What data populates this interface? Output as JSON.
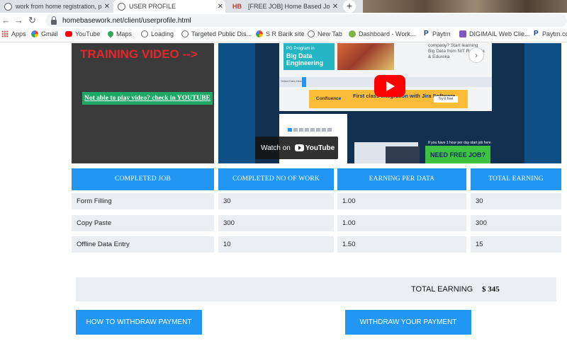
{
  "browser": {
    "tabs": [
      {
        "title": "work from home registration, pa"
      },
      {
        "title": "USER PROFILE"
      },
      {
        "title": "[FREE JOB] Home Based Jobs Wit",
        "favicon_text": "HB"
      }
    ],
    "url": "homebasework.net/client/userprofile.html",
    "bookmarks": [
      {
        "label": "Apps",
        "icon": "apps-grid-icon"
      },
      {
        "label": "Gmail",
        "icon": "google-icon"
      },
      {
        "label": "YouTube",
        "icon": "youtube-icon"
      },
      {
        "label": "Maps",
        "icon": "maps-pin-icon"
      },
      {
        "label": "Loading",
        "icon": "globe-icon"
      },
      {
        "label": "Targeted Public Dis...",
        "icon": "globe-icon"
      },
      {
        "label": "S R Barik site",
        "icon": "google-icon"
      },
      {
        "label": "New Tab",
        "icon": "globe-icon"
      },
      {
        "label": "Dashboard - Work...",
        "icon": "dashboard-icon"
      },
      {
        "label": "Paytm",
        "icon": "paytm-icon"
      },
      {
        "label": "DIGIMAIL Web Clie...",
        "icon": "digimail-icon"
      },
      {
        "label": "Paytm.co",
        "icon": "paytm-icon"
      }
    ]
  },
  "training": {
    "heading": "TRAINING VIDEO -->",
    "youtube_link": "Not able to play video? check in YOUTUBE"
  },
  "video": {
    "big_data_small": "PG Program in",
    "big_data_title": "Big Data Engineering",
    "right_text": "company? Start learning Big Data from NIT Rourkela & Edureka",
    "ad_brand": "Confluence",
    "ad_text": "First class integration with Jira Software",
    "ad_button": "Try it free",
    "need_free": "NEED FREE JOB?",
    "need_free_header": "If you have 1 hour per day start job here",
    "select_label": "Select Data Here",
    "watch_on": "Watch on",
    "yt_brand": "YouTube"
  },
  "table": {
    "headers": [
      "COMPLETED JOB",
      "COMPLETED NO OF WORK",
      "EARNING PER DATA",
      "TOTAL EARNING"
    ],
    "rows": [
      [
        "Form Filling",
        "30",
        "1.00",
        "30"
      ],
      [
        "Copy Paste",
        "300",
        "1.00",
        "300"
      ],
      [
        "Offline Data Entry",
        "10",
        "1.50",
        "15"
      ]
    ]
  },
  "total": {
    "label": "TOTAL EARNING",
    "value": "$ 345"
  },
  "buttons": {
    "how_to": "HOW TO WITHDRAW PAYMENT",
    "withdraw": "WITHDRAW YOUR PAYMENT"
  }
}
